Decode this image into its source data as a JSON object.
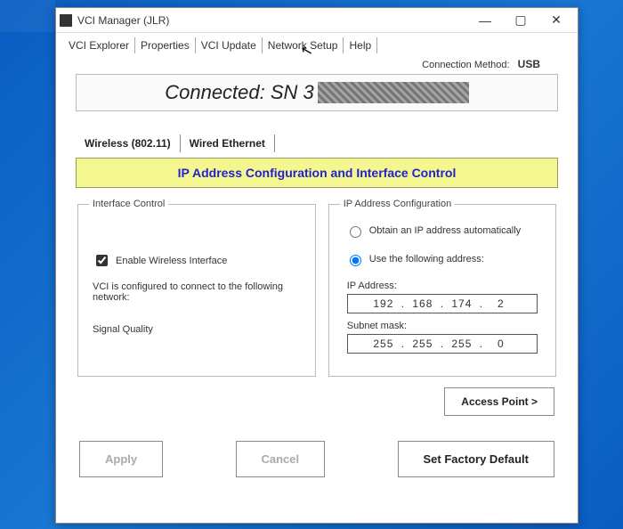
{
  "window": {
    "title": "VCI Manager (JLR)"
  },
  "menu": {
    "items": [
      "VCI Explorer",
      "Properties",
      "VCI Update",
      "Network Setup",
      "Help"
    ]
  },
  "connection": {
    "label": "Connection Method:",
    "value": "USB"
  },
  "status": {
    "prefix": "Connected: SN 3"
  },
  "subtabs": {
    "items": [
      "Wireless (802.11)",
      "Wired Ethernet"
    ]
  },
  "banner": "IP Address Configuration and Interface Control",
  "interface_control": {
    "legend": "Interface Control",
    "enable_label": "Enable Wireless Interface",
    "note": "VCI is configured to connect to the following network:",
    "signal_label": "Signal Quality"
  },
  "ip_config": {
    "legend": "IP Address Configuration",
    "auto_label": "Obtain an IP address automatically",
    "manual_label": "Use the following address:",
    "ip_label": "IP Address:",
    "ip": [
      "192",
      "168",
      "174",
      "2"
    ],
    "mask_label": "Subnet mask:",
    "mask": [
      "255",
      "255",
      "255",
      "0"
    ]
  },
  "buttons": {
    "access_point": "Access Point >",
    "apply": "Apply",
    "cancel": "Cancel",
    "factory": "Set Factory Default"
  }
}
